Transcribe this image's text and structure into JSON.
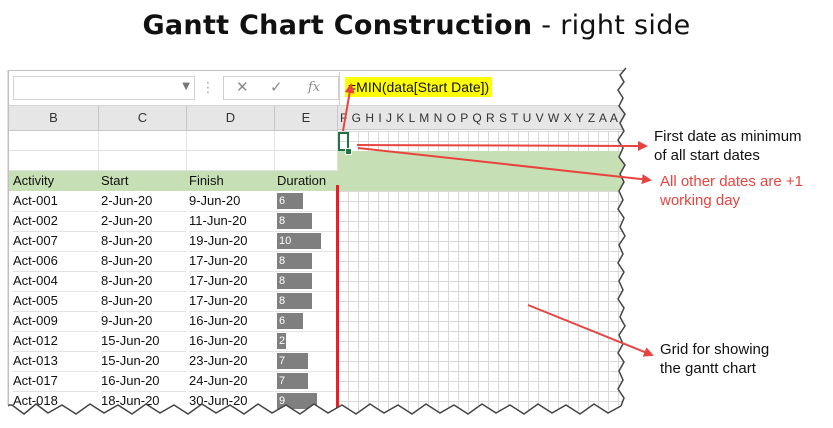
{
  "title": {
    "bold": "Gantt Chart Construction",
    "rest": "- right side"
  },
  "formula_bar": {
    "cancel_icon": "close-icon",
    "confirm_icon": "check-icon",
    "fx_label": "fx",
    "formula": "=MIN(data[Start Date])"
  },
  "columns": [
    "B",
    "C",
    "D",
    "E"
  ],
  "gantt_columns": "F G H I J K L M N O P Q R S T U V W X Y Z A A A A A A A",
  "table": {
    "headers": [
      "Activity",
      "Start",
      "Finish",
      "Duration"
    ],
    "rows": [
      {
        "activity": "Act-001",
        "start": "2-Jun-20",
        "finish": "9-Jun-20",
        "duration": 6
      },
      {
        "activity": "Act-002",
        "start": "2-Jun-20",
        "finish": "11-Jun-20",
        "duration": 8
      },
      {
        "activity": "Act-007",
        "start": "8-Jun-20",
        "finish": "19-Jun-20",
        "duration": 10
      },
      {
        "activity": "Act-006",
        "start": "8-Jun-20",
        "finish": "17-Jun-20",
        "duration": 8
      },
      {
        "activity": "Act-004",
        "start": "8-Jun-20",
        "finish": "17-Jun-20",
        "duration": 8
      },
      {
        "activity": "Act-005",
        "start": "8-Jun-20",
        "finish": "17-Jun-20",
        "duration": 8
      },
      {
        "activity": "Act-009",
        "start": "9-Jun-20",
        "finish": "16-Jun-20",
        "duration": 6
      },
      {
        "activity": "Act-012",
        "start": "15-Jun-20",
        "finish": "16-Jun-20",
        "duration": 2
      },
      {
        "activity": "Act-013",
        "start": "15-Jun-20",
        "finish": "23-Jun-20",
        "duration": 7
      },
      {
        "activity": "Act-017",
        "start": "16-Jun-20",
        "finish": "24-Jun-20",
        "duration": 7
      },
      {
        "activity": "Act-018",
        "start": "18-Jun-20",
        "finish": "30-Jun-20",
        "duration": 9
      }
    ]
  },
  "annotations": {
    "first_date": [
      "First date as minimum",
      "of all start dates"
    ],
    "other_dates": [
      "All other dates are +1",
      "working day"
    ],
    "grid": [
      "Grid for showing",
      "the gantt chart"
    ]
  },
  "colors": {
    "green_band": "#c6dfb4",
    "red": "#ee1c25",
    "highlight": "#ffff00",
    "bar": "#7f7f7f"
  }
}
